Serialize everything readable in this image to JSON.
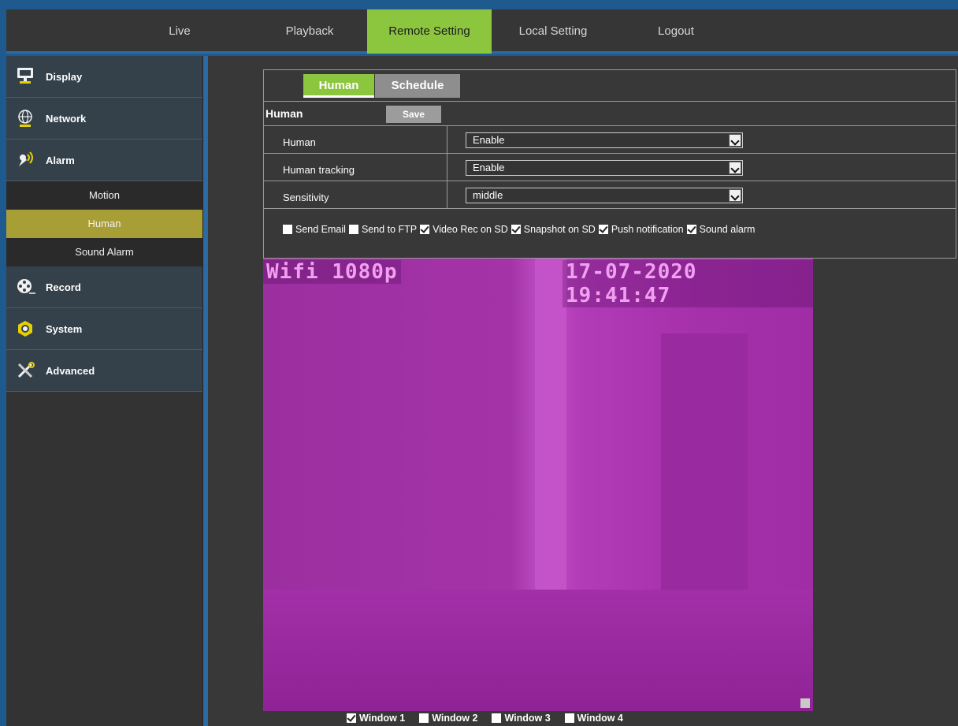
{
  "topnav": {
    "items": [
      {
        "label": "Live"
      },
      {
        "label": "Playback"
      },
      {
        "label": "Remote Setting"
      },
      {
        "label": "Local Setting"
      },
      {
        "label": "Logout"
      }
    ],
    "active": "Remote Setting"
  },
  "sidebar": {
    "categories": [
      {
        "label": "Display",
        "icon": "monitor-icon"
      },
      {
        "label": "Network",
        "icon": "globe-icon"
      },
      {
        "label": "Alarm",
        "icon": "alarm-icon"
      },
      {
        "label": "Record",
        "icon": "film-reel-icon"
      },
      {
        "label": "System",
        "icon": "nut-icon"
      },
      {
        "label": "Advanced",
        "icon": "tools-icon"
      }
    ],
    "alarm_sub": [
      {
        "label": "Motion"
      },
      {
        "label": "Human"
      },
      {
        "label": "Sound Alarm"
      }
    ],
    "active_sub": "Human"
  },
  "tabs": [
    {
      "label": "Human"
    },
    {
      "label": "Schedule"
    }
  ],
  "section": {
    "title": "Human",
    "save_label": "Save"
  },
  "fields": [
    {
      "label": "Human",
      "value": "Enable"
    },
    {
      "label": "Human tracking",
      "value": "Enable"
    },
    {
      "label": "Sensitivity",
      "value": "middle"
    }
  ],
  "actions": [
    {
      "label": "Send Email",
      "checked": false
    },
    {
      "label": "Send to FTP",
      "checked": false
    },
    {
      "label": "Video Rec on SD",
      "checked": true
    },
    {
      "label": "Snapshot on SD",
      "checked": true
    },
    {
      "label": "Push notification",
      "checked": true
    },
    {
      "label": "Sound alarm",
      "checked": true
    }
  ],
  "video": {
    "osd_left": "Wifi 1080p",
    "osd_right": "17-07-2020 19:41:47",
    "tint": "#a433a8"
  },
  "windows": [
    {
      "label": "Window 1",
      "checked": true
    },
    {
      "label": "Window 2",
      "checked": false
    },
    {
      "label": "Window 3",
      "checked": false
    },
    {
      "label": "Window 4",
      "checked": false
    }
  ],
  "colors": {
    "accent_green": "#8cc63f",
    "active_sub": "#a89e36",
    "frame_blue": "#2b6aa3"
  }
}
